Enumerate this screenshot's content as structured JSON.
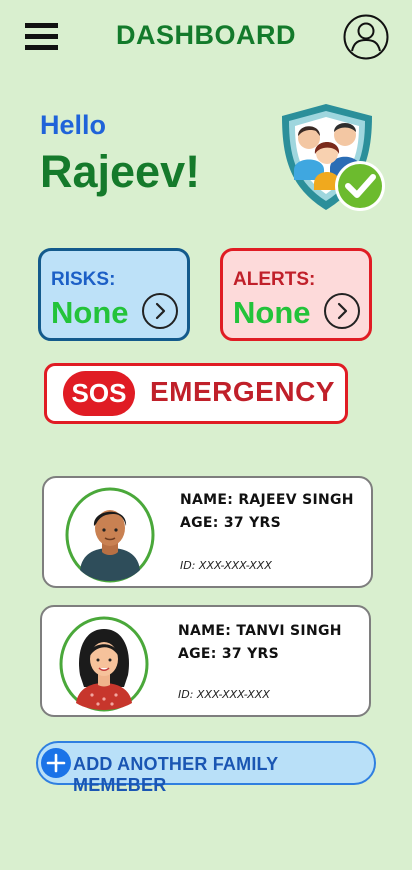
{
  "header": {
    "title": "DASHBOARD",
    "menu_icon": "hamburger-menu-icon",
    "profile_icon": "user-profile-icon"
  },
  "greeting": {
    "hello": "Hello",
    "name": "Rajeev!",
    "emblem_icon": "family-shield-check-icon"
  },
  "status": {
    "risks": {
      "label": "RISKS:",
      "value": "None",
      "icon": "chevron-right-icon"
    },
    "alerts": {
      "label": "ALERTS:",
      "value": "None",
      "icon": "chevron-right-icon"
    }
  },
  "sos": {
    "badge": "SOS",
    "label": "EMERGENCY"
  },
  "members": [
    {
      "name": "NAME: RAJEEV SINGH",
      "age": "AGE: 37 YRS",
      "id": "ID: XXX-XXX-XXX",
      "avatar": "male-avatar"
    },
    {
      "name": "NAME: TANVI SINGH",
      "age": "AGE: 37 YRS",
      "id": "ID: XXX-XXX-XXX",
      "avatar": "female-avatar"
    }
  ],
  "add_member": {
    "label": "ADD ANOTHER FAMILY MEMEBER",
    "icon": "plus-icon"
  },
  "colors": {
    "background": "#d9efcf",
    "title_green": "#137a2b",
    "hello_blue": "#1f63d9",
    "status_green": "#23c33a",
    "alert_red": "#e01c24",
    "risk_border": "#135a8c"
  }
}
